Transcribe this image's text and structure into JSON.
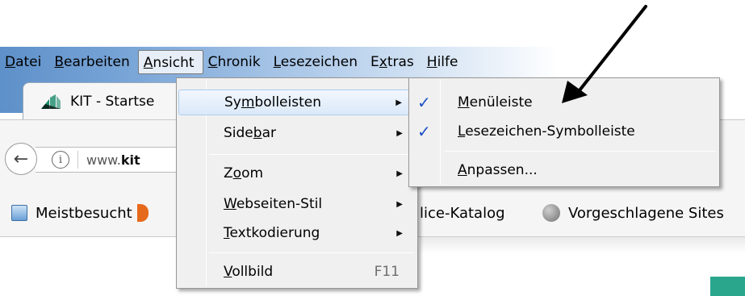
{
  "menubar": {
    "items": [
      {
        "pre": "",
        "u": "D",
        "post": "atei"
      },
      {
        "pre": "",
        "u": "B",
        "post": "earbeiten"
      },
      {
        "pre": "",
        "u": "A",
        "post": "nsicht"
      },
      {
        "pre": "",
        "u": "C",
        "post": "hronik"
      },
      {
        "pre": "",
        "u": "L",
        "post": "esezeichen"
      },
      {
        "pre": "E",
        "u": "x",
        "post": "tras"
      },
      {
        "pre": "",
        "u": "H",
        "post": "ilfe"
      }
    ]
  },
  "tab": {
    "title": "KIT - Startse"
  },
  "urlbar": {
    "info_glyph": "i",
    "prefix": "www.",
    "domain": "kit"
  },
  "back_glyph": "←",
  "bookmarks": {
    "meistbesucht": "Meistbesucht",
    "katalog": "lice-Katalog",
    "vorgeschlagen": "Vorgeschlagene Sites"
  },
  "ansicht_menu": {
    "items": [
      {
        "pre": "Sy",
        "u": "m",
        "post": "bolleisten",
        "submenu": true
      },
      {
        "pre": "Side",
        "u": "b",
        "post": "ar",
        "submenu": true
      },
      {
        "pre": "Z",
        "u": "o",
        "post": "om",
        "submenu": true
      },
      {
        "pre": "",
        "u": "W",
        "post": "ebseiten-Stil",
        "submenu": true
      },
      {
        "pre": "",
        "u": "T",
        "post": "extkodierung",
        "submenu": true
      },
      {
        "pre": "",
        "u": "V",
        "post": "ollbild",
        "shortcut": "F11"
      }
    ],
    "submenu_glyph": "▶"
  },
  "symbolleisten_menu": {
    "items": [
      {
        "pre": "",
        "u": "M",
        "post": "enüleiste",
        "checked": true
      },
      {
        "pre": "",
        "u": "L",
        "post": "esezeichen-Symbolleiste",
        "checked": true
      },
      {
        "pre": "",
        "u": "A",
        "post": "npassen...",
        "checked": false
      }
    ],
    "check_glyph": "✓"
  },
  "colors": {
    "menu_bg": "#f0f0f0",
    "highlight": "#dbe9f9",
    "check": "#1d50c7",
    "annotation_arrow": "#000000"
  }
}
